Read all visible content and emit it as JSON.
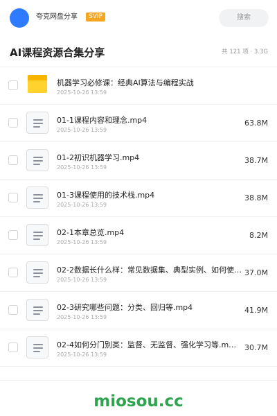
{
  "topbar": {
    "username": "夸克网盘分享",
    "vip_badge": "SVIP",
    "search_placeholder": "搜索"
  },
  "header": {
    "title": "AI课程资源合集分享",
    "summary": "共 121 项 · 3.3G"
  },
  "items": [
    {
      "name": "机器学习必修课：经典AI算法与编程实战",
      "date": "2025-10-26 13:59",
      "size": "",
      "type": "folder"
    },
    {
      "name": "01-1课程内容和理念.mp4",
      "date": "2025-10-26 13:59",
      "size": "63.8M",
      "type": "file"
    },
    {
      "name": "01-2初识机器学习.mp4",
      "date": "2025-10-26 13:59",
      "size": "38.7M",
      "type": "file"
    },
    {
      "name": "01-3课程使用的技术栈.mp4",
      "date": "2025-10-26 13:59",
      "size": "38.8M",
      "type": "file"
    },
    {
      "name": "02-1本章总览.mp4",
      "date": "2025-10-26 13:59",
      "size": "8.2M",
      "type": "file"
    },
    {
      "name": "02-2数据长什么样：常见数据集、典型实例、如何使…",
      "date": "2025-10-26 13:59",
      "size": "37.0M",
      "type": "file"
    },
    {
      "name": "02-3研究哪些问题：分类、回归等.mp4",
      "date": "2025-10-26 13:59",
      "size": "41.9M",
      "type": "file"
    },
    {
      "name": "02-4如何分门别类：监督、无监督、强化学习等.m…",
      "date": "2025-10-26 13:59",
      "size": "30.7M",
      "type": "file"
    }
  ],
  "watermark": "miosou.cc",
  "colors": {
    "avatar": "#2f7bff",
    "vip_badge": "#f5a623",
    "folder": "#ffd22e",
    "watermark": "#2ea44f"
  }
}
